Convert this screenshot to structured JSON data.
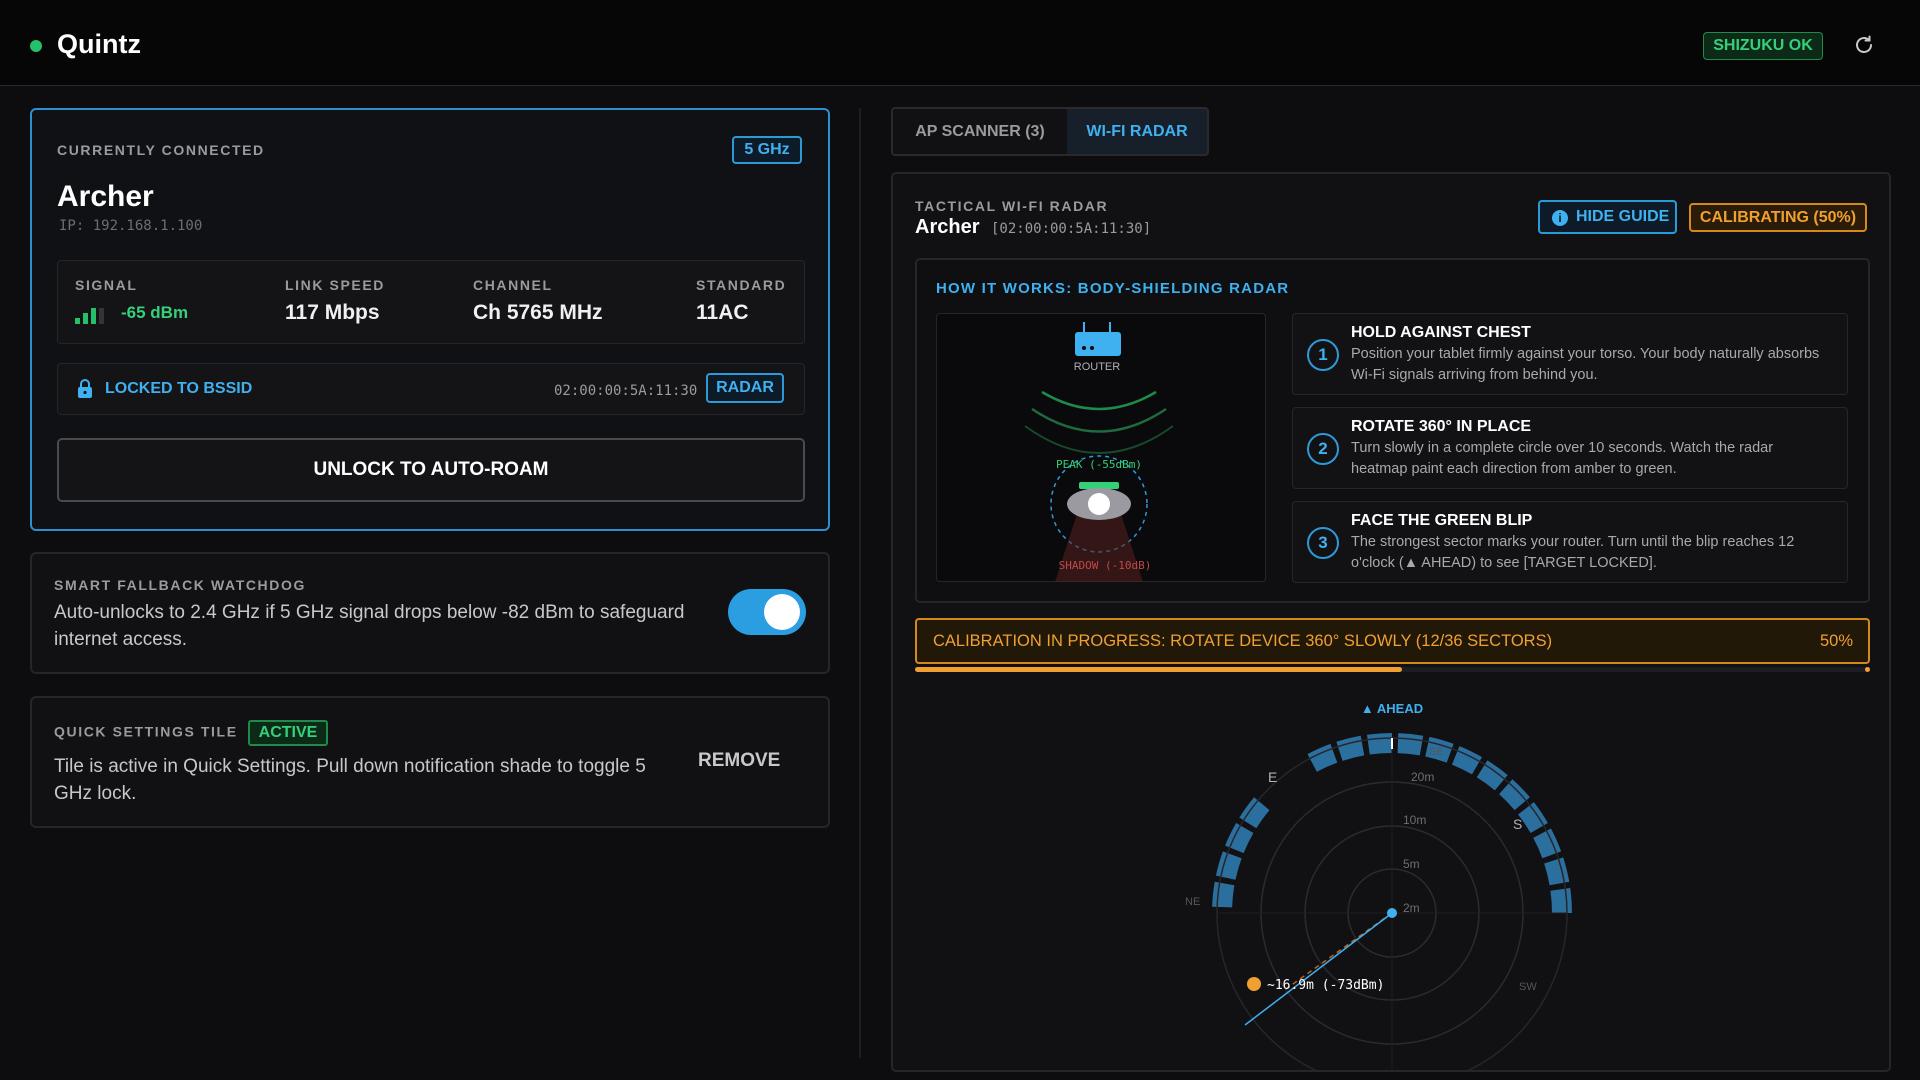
{
  "header": {
    "title": "Quintz",
    "status_badge": "SHIZUKU OK",
    "refresh_icon": "refresh-icon"
  },
  "connection": {
    "label": "CURRENTLY CONNECTED",
    "band": "5 GHz",
    "ssid": "Archer",
    "ip": "IP: 192.168.1.100",
    "stats": [
      {
        "label": "SIGNAL",
        "value": "-65 dBm",
        "bars": 3
      },
      {
        "label": "LINK SPEED",
        "value": "117 Mbps"
      },
      {
        "label": "CHANNEL",
        "value": "Ch 5765 MHz"
      },
      {
        "label": "STANDARD",
        "value": "11AC"
      }
    ],
    "lock_label": "LOCKED TO BSSID",
    "bssid": "02:00:00:5A:11:30",
    "radar_button": "RADAR",
    "unlock_button": "UNLOCK TO AUTO-ROAM"
  },
  "watchdog": {
    "label": "SMART FALLBACK WATCHDOG",
    "description": "Auto-unlocks to 2.4 GHz if 5 GHz signal drops below -82 dBm to safeguard internet access.",
    "enabled": true
  },
  "quick_settings": {
    "label": "QUICK SETTINGS TILE",
    "badge": "ACTIVE",
    "description": "Tile is active in Quick Settings. Pull down notification shade to toggle 5 GHz lock.",
    "remove_button": "REMOVE"
  },
  "tabs": [
    {
      "label": "AP SCANNER (3)",
      "selected": false
    },
    {
      "label": "WI-FI RADAR",
      "selected": true
    }
  ],
  "radar": {
    "label": "TACTICAL WI-FI RADAR",
    "ssid": "Archer",
    "bssid": "[02:00:00:5A:11:30]",
    "hide_guide": "HIDE GUIDE",
    "status": "CALIBRATING (50%)",
    "guide": {
      "title": "HOW IT WORKS: BODY-SHIELDING RADAR",
      "diagram": {
        "router": "ROUTER",
        "peak": "PEAK (-55dBm)",
        "shadow": "SHADOW (-10dB)"
      },
      "steps": [
        {
          "num": "1",
          "title": "HOLD AGAINST CHEST",
          "text": "Position your tablet firmly against your torso. Your body naturally absorbs Wi-Fi signals arriving from behind you."
        },
        {
          "num": "2",
          "title": "ROTATE 360° IN PLACE",
          "text": "Turn slowly in a complete circle over 10 seconds. Watch the radar heatmap paint each direction from amber to green."
        },
        {
          "num": "3",
          "title": "FACE THE GREEN BLIP",
          "text": "The strongest sector marks your router. Turn until the blip reaches 12 o'clock (▲ AHEAD) to see [TARGET LOCKED]."
        }
      ]
    },
    "calibration_text": "CALIBRATION IN PROGRESS: ROTATE DEVICE 360° SLOWLY (12/36 SECTORS)",
    "calibration_pct": "50%",
    "calibration_progress": 0.51,
    "scope": {
      "ahead": "▲ AHEAD",
      "rings": [
        "20m",
        "10m",
        "5m",
        "2m"
      ],
      "directions": {
        "n": "N",
        "ne": "NE",
        "e": "E",
        "se": "SE",
        "s": "S",
        "sw": "SW"
      },
      "blip_label": "~16.9m (-73dBm)",
      "colors": {
        "sector": "#2b6f9e",
        "blip": "#f0a030",
        "center": "#3fb0f0",
        "north": "#27c06a"
      }
    }
  }
}
